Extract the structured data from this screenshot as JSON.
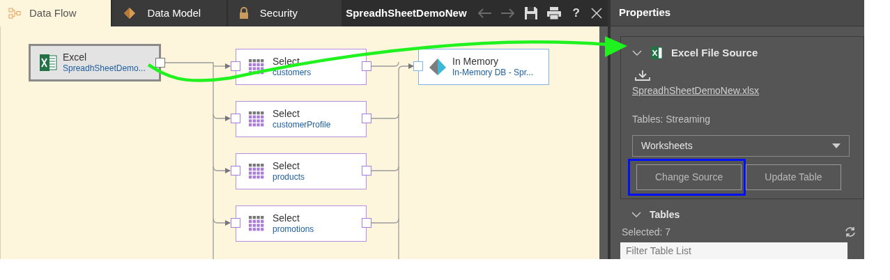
{
  "tabs": [
    {
      "label": "Data Flow",
      "selected": true
    },
    {
      "label": "Data Model",
      "selected": false
    },
    {
      "label": "Security",
      "selected": false
    }
  ],
  "document_title": "SpreadhSheetDemoNew",
  "toolbar": {
    "help": "?"
  },
  "nodes": [
    {
      "kind": "source",
      "title": "Excel",
      "subtitle": "SpreadhSheetDemo..."
    },
    {
      "kind": "select",
      "title": "Select",
      "subtitle": "customers"
    },
    {
      "kind": "select",
      "title": "Select",
      "subtitle": "customerProfile"
    },
    {
      "kind": "select",
      "title": "Select",
      "subtitle": "products"
    },
    {
      "kind": "select",
      "title": "Select",
      "subtitle": "promotions"
    },
    {
      "kind": "target",
      "title": "In Memory",
      "subtitle": "In-Memory DB - Spr..."
    }
  ],
  "properties": {
    "title": "Properties",
    "source_section": {
      "title": "Excel File Source",
      "expanded": true,
      "file_link": "SpreadhSheetDemoNew.xlsx",
      "tables_label": "Tables: Streaming",
      "dropdown_value": "Worksheets",
      "buttons": [
        {
          "label": "Change Source",
          "highlighted": true
        },
        {
          "label": "Update Table",
          "highlighted": false
        }
      ]
    },
    "tables_section": {
      "title": "Tables",
      "expanded": true,
      "selected_count": "Selected: 7",
      "filter_placeholder": "Filter Table List"
    }
  }
}
